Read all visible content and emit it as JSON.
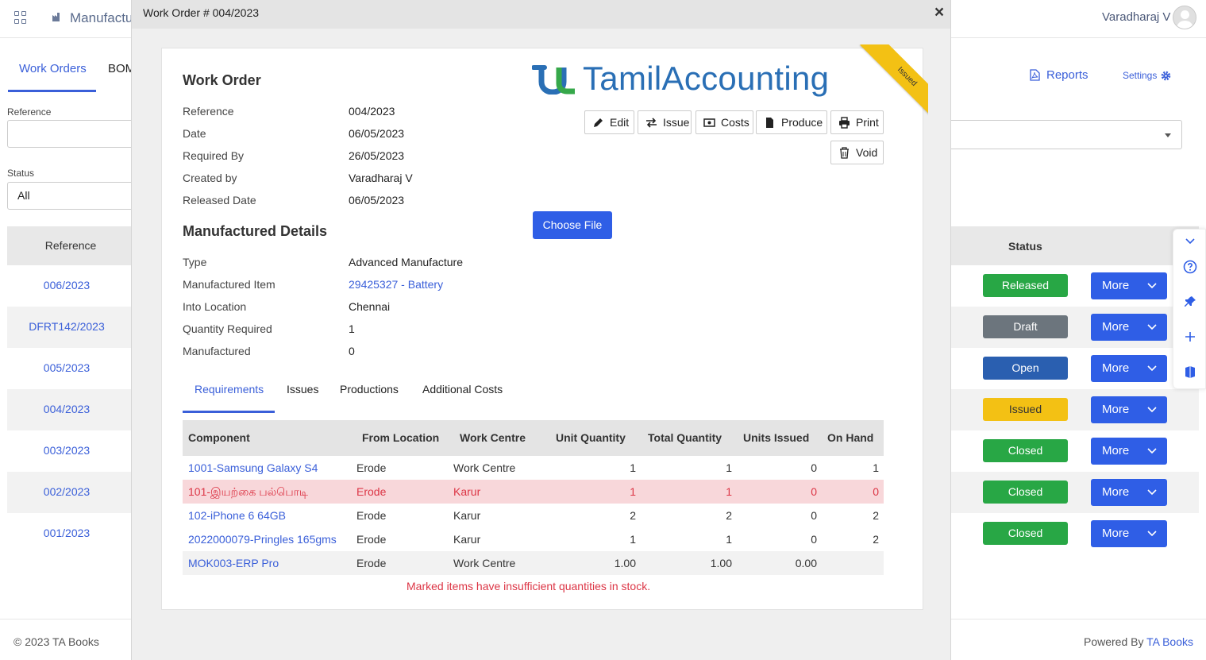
{
  "app": {
    "title": "Manufacturing",
    "user_name": "Varadharaj V",
    "tabs": [
      "Work Orders",
      "BOM"
    ],
    "reports_label": "Reports",
    "settings_label": "Settings",
    "filters": {
      "reference_label": "Reference",
      "reference_value": "",
      "status_label": "Status",
      "status_value": "All"
    },
    "table": {
      "col_reference": "Reference",
      "col_status": "Status",
      "rows": [
        {
          "ref": "006/2023",
          "status": "Released",
          "more": "More"
        },
        {
          "ref": "DFRT142/2023",
          "status": "Draft",
          "more": "More"
        },
        {
          "ref": "005/2023",
          "status": "Open",
          "more": "More"
        },
        {
          "ref": "004/2023",
          "status": "Issued",
          "more": "More"
        },
        {
          "ref": "003/2023",
          "status": "Closed",
          "more": "More"
        },
        {
          "ref": "002/2023",
          "status": "Closed",
          "more": "More"
        },
        {
          "ref": "001/2023",
          "status": "Closed",
          "more": "More"
        }
      ]
    },
    "status_colors": {
      "Released": "#28a745",
      "Draft": "#6c757d",
      "Open": "#2a5fb0",
      "Issued": "#f3c114",
      "Closed": "#28a745"
    },
    "footer": {
      "copyright": "© 2023 TA Books",
      "powered_by": "Powered By",
      "powered_link": "TA Books"
    },
    "side_panel_icons": [
      "chevron-down-icon",
      "help-icon",
      "pin-icon",
      "plus-icon",
      "book-icon"
    ]
  },
  "modal": {
    "title": "Work Order # 004/2023",
    "close": "×",
    "logo_text": "TamilAccounting",
    "ribbon": "Issued",
    "work_order": {
      "heading": "Work Order",
      "fields": [
        {
          "label": "Reference",
          "value": "004/2023"
        },
        {
          "label": "Date",
          "value": "06/05/2023"
        },
        {
          "label": "Required By",
          "value": "26/05/2023"
        },
        {
          "label": "Created by",
          "value": "Varadharaj V"
        },
        {
          "label": "Released Date",
          "value": "06/05/2023"
        }
      ]
    },
    "actions": {
      "edit": "Edit",
      "issue": "Issue",
      "costs": "Costs",
      "produce": "Produce",
      "print": "Print",
      "void": "Void"
    },
    "choose_file": "Choose File",
    "manufactured": {
      "heading": "Manufactured Details",
      "fields": [
        {
          "label": "Type",
          "value": "Advanced Manufacture"
        },
        {
          "label": "Manufactured Item",
          "value": "29425327 - Battery"
        },
        {
          "label": "Into Location",
          "value": "Chennai"
        },
        {
          "label": "Quantity Required",
          "value": "1"
        },
        {
          "label": "Manufactured",
          "value": "0"
        }
      ]
    },
    "tabs": [
      "Requirements",
      "Issues",
      "Productions",
      "Additional Costs"
    ],
    "requirements": {
      "columns": [
        "Component",
        "From Location",
        "Work Centre",
        "Unit Quantity",
        "Total Quantity",
        "Units Issued",
        "On Hand"
      ],
      "rows": [
        {
          "component": "1001-Samsung Galaxy S4",
          "from": "Erode",
          "wc": "Work Centre",
          "uq": "1",
          "tq": "1",
          "ui": "0",
          "oh": "1"
        },
        {
          "component": "101-இயற்கை பல்பொடி",
          "from": "Erode",
          "wc": "Karur",
          "uq": "1",
          "tq": "1",
          "ui": "0",
          "oh": "0"
        },
        {
          "component": "102-iPhone 6 64GB",
          "from": "Erode",
          "wc": "Karur",
          "uq": "2",
          "tq": "2",
          "ui": "0",
          "oh": "2"
        },
        {
          "component": "2022000079-Pringles 165gms",
          "from": "Erode",
          "wc": "Karur",
          "uq": "1",
          "tq": "1",
          "ui": "0",
          "oh": "2"
        },
        {
          "component": "MOK003-ERP Pro",
          "from": "Erode",
          "wc": "Work Centre",
          "uq": "1.00",
          "tq": "1.00",
          "ui": "0.00",
          "oh": ""
        }
      ],
      "warning": "Marked items have insufficient quantities in stock."
    }
  }
}
